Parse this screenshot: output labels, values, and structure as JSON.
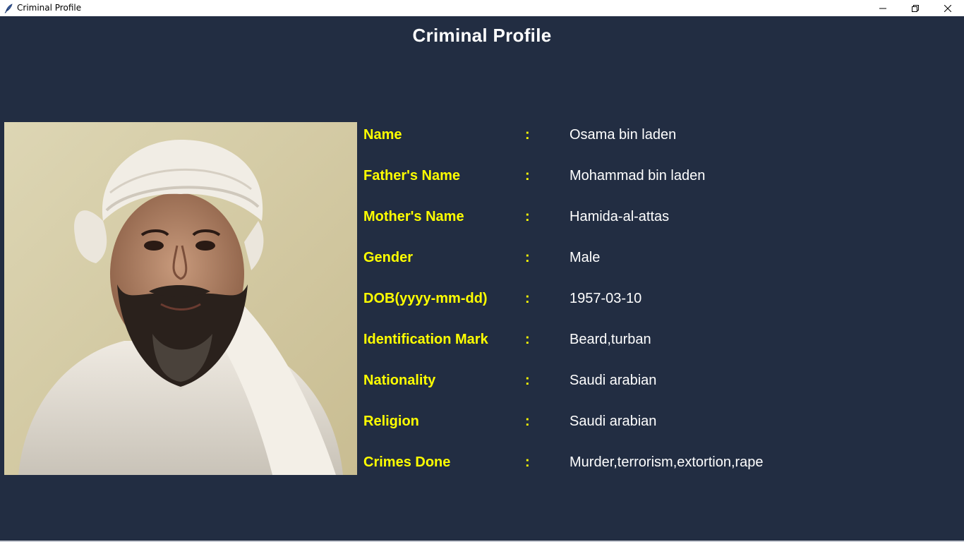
{
  "window": {
    "title": "Criminal Profile",
    "controls": [
      "minimize-icon",
      "restore-icon",
      "close-icon"
    ]
  },
  "page": {
    "title": "Criminal Profile"
  },
  "colors": {
    "background": "#222d42",
    "label": "#ffff00",
    "value": "#ffffff",
    "title": "#ffffff"
  },
  "profile": {
    "photo_icon": "person-photo",
    "separator": ":",
    "fields": [
      {
        "label": "Name",
        "value": "Osama bin laden"
      },
      {
        "label": "Father's Name",
        "value": "Mohammad bin laden"
      },
      {
        "label": "Mother's Name",
        "value": "Hamida-al-attas"
      },
      {
        "label": "Gender",
        "value": "Male"
      },
      {
        "label": "DOB(yyyy-mm-dd)",
        "value": "1957-03-10"
      },
      {
        "label": "Identification Mark",
        "value": "Beard,turban"
      },
      {
        "label": "Nationality",
        "value": "Saudi arabian"
      },
      {
        "label": "Religion",
        "value": "Saudi arabian"
      },
      {
        "label": "Crimes Done",
        "value": "Murder,terrorism,extortion,rape"
      }
    ]
  }
}
